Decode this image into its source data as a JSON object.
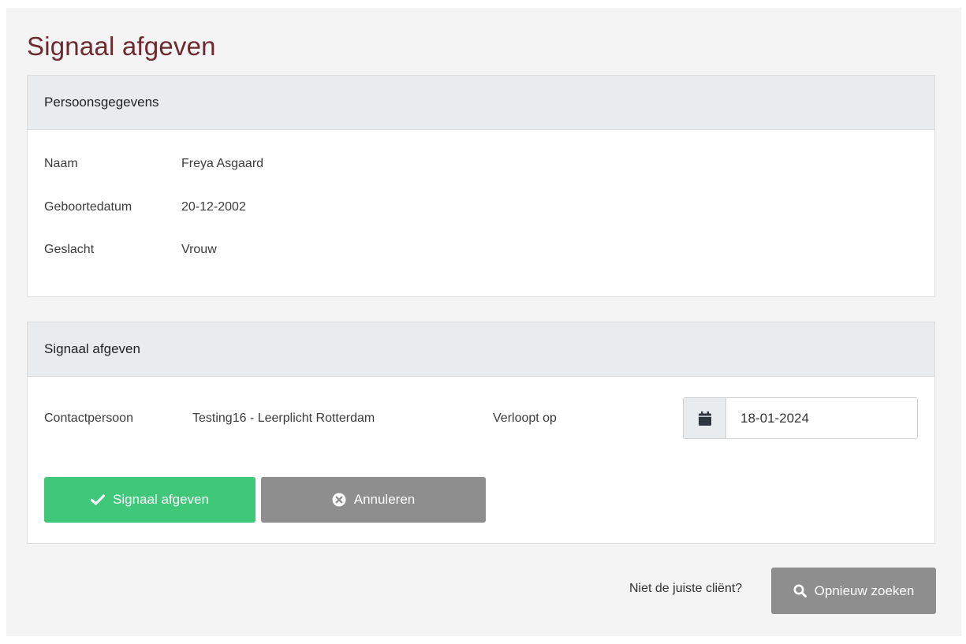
{
  "page": {
    "title": "Signaal afgeven"
  },
  "person_card": {
    "header": "Persoonsgegevens",
    "rows": [
      {
        "label": "Naam",
        "value": "Freya Asgaard"
      },
      {
        "label": "Geboortedatum",
        "value": "20-12-2002"
      },
      {
        "label": "Geslacht",
        "value": "Vrouw"
      }
    ]
  },
  "signal_card": {
    "header": "Signaal afgeven",
    "contact_label": "Contactpersoon",
    "contact_value": "Testing16 - Leerplicht Rotterdam",
    "expires_label": "Verloopt op",
    "expires_value": "18-01-2024",
    "submit_label": "Signaal afgeven",
    "cancel_label": "Annuleren"
  },
  "footer": {
    "question": "Niet de juiste cliënt?",
    "search_label": "Opnieuw zoeken"
  },
  "icons": {
    "check": "check-icon",
    "cancel": "times-circle-icon",
    "calendar": "calendar-icon",
    "search": "search-icon"
  },
  "colors": {
    "title": "#6b2a2f",
    "primary_button": "#3fc77a",
    "secondary_button": "#8e8e8e",
    "card_header": "#e8ecef",
    "page_background": "#f4f4f4"
  }
}
